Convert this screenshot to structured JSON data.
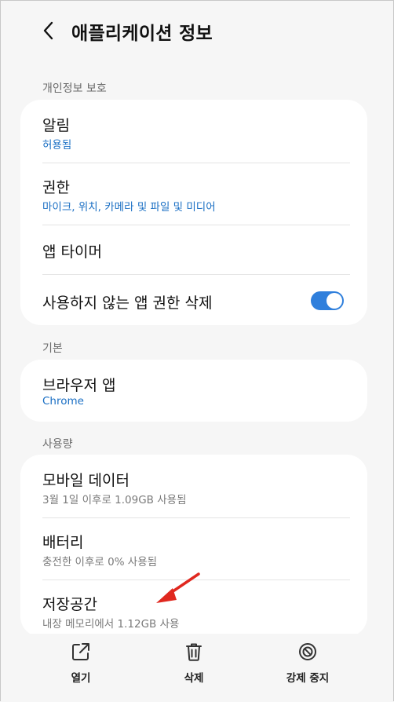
{
  "header": {
    "title": "애플리케이션 정보"
  },
  "sections": {
    "privacy": {
      "label": "개인정보 보호"
    },
    "basic": {
      "label": "기본"
    },
    "usage": {
      "label": "사용량"
    }
  },
  "privacy_items": {
    "notifications": {
      "title": "알림",
      "subtitle": "허용됨"
    },
    "permissions": {
      "title": "권한",
      "subtitle": "마이크, 위치, 카메라 및 파일 및 미디어"
    },
    "app_timer": {
      "title": "앱 타이머"
    },
    "remove_permissions": {
      "title": "사용하지 않는 앱 권한 삭제",
      "toggle_on": true
    }
  },
  "basic_items": {
    "browser_app": {
      "title": "브라우저 앱",
      "subtitle": "Chrome"
    }
  },
  "usage_items": {
    "mobile_data": {
      "title": "모바일 데이터",
      "subtitle": "3월 1일 이후로 1.09GB 사용됨"
    },
    "battery": {
      "title": "배터리",
      "subtitle": "충전한 이후로 0% 사용됨"
    },
    "storage": {
      "title": "저장공간",
      "subtitle": "내장 메모리에서 1.12GB 사용"
    }
  },
  "bottom_actions": {
    "open": {
      "label": "열기",
      "icon": "open-external-icon"
    },
    "uninstall": {
      "label": "삭제",
      "icon": "trash-icon"
    },
    "force_stop": {
      "label": "강제 중지",
      "icon": "block-icon"
    }
  },
  "colors": {
    "accent": "#2f7fdc",
    "link": "#1a6fc4",
    "annotation_arrow": "#e0281f"
  }
}
